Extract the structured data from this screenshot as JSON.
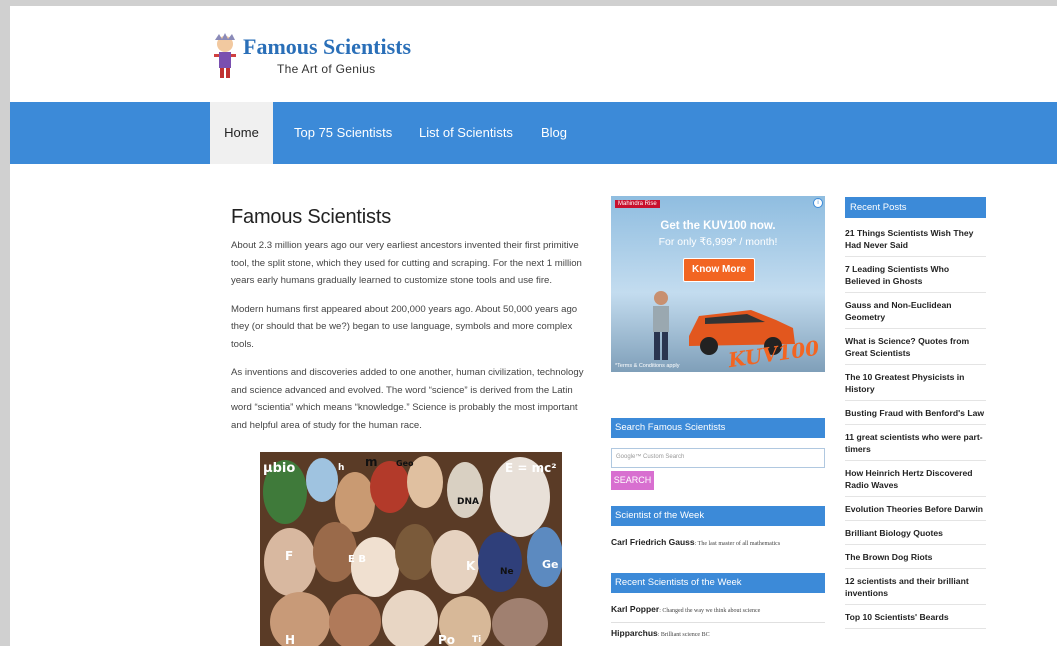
{
  "site": {
    "title": "Famous Scientists",
    "tagline": "The Art of Genius"
  },
  "nav": {
    "items": [
      {
        "label": "Home",
        "active": true
      },
      {
        "label": "Top 75 Scientists",
        "active": false
      },
      {
        "label": "List of Scientists",
        "active": false
      },
      {
        "label": "Blog",
        "active": false
      }
    ]
  },
  "main": {
    "title": "Famous Scientists",
    "paragraphs": [
      "About 2.3 million years ago our very earliest ancestors invented their first primitive tool, the split stone, which they used for cutting and scraping. For the next 1 million years early humans gradually learned to customize stone tools and use fire.",
      "Modern humans first appeared about 200,000 years ago. About 50,000 years ago they (or should that be we?) began to use language, symbols and more complex tools.",
      "As inventions and discoveries added to one another, human civilization, technology and science advanced and evolved. The word “science” is derived from the Latin word “scientia” which means “knowledge.” Science is probably the most important and helpful area of study for the human race."
    ],
    "collage_labels": [
      "μbio",
      "h",
      "m",
      "Geo",
      "E = mc²",
      "DNA",
      "E B",
      "F",
      "K",
      "Ne",
      "Ge",
      "H",
      "Po",
      "Ti"
    ]
  },
  "ad": {
    "brand": "Mahindra Rise",
    "headline": "Get the KUV100 now.",
    "subline": "For only ₹6,999* / month!",
    "button": "Know More",
    "terms": "*Terms & Conditions apply",
    "logo": "KUV100"
  },
  "search": {
    "heading": "Search Famous Scientists",
    "placeholder": "Google™ Custom Search",
    "button": "SEARCH"
  },
  "scientist_of_week": {
    "heading": "Scientist of the Week",
    "name": "Carl Friedrich Gauss",
    "desc": ": The last master of all mathematics"
  },
  "recent_scientists": {
    "heading": "Recent Scientists of the Week",
    "items": [
      {
        "name": "Karl Popper",
        "desc": ": Changed the way we think about science"
      },
      {
        "name": "Hipparchus",
        "desc": ": Brilliant science BC"
      }
    ]
  },
  "recent_posts": {
    "heading": "Recent Posts",
    "items": [
      "21 Things Scientists Wish They Had Never Said",
      "7 Leading Scientists Who Believed in Ghosts",
      "Gauss and Non-Euclidean Geometry",
      "What is Science? Quotes from Great Scientists",
      "The 10 Greatest Physicists in History",
      "Busting Fraud with Benford's Law",
      "11 great scientists who were part-timers",
      "How Heinrich Hertz Discovered Radio Waves",
      "Evolution Theories Before Darwin",
      "Brilliant Biology Quotes",
      "The Brown Dog Riots",
      "12 scientists and their brilliant inventions",
      "Top 10 Scientists' Beards"
    ]
  },
  "colors": {
    "nav_blue": "#3c8ad8",
    "search_button": "#d86fd0",
    "ad_button": "#f26522"
  }
}
